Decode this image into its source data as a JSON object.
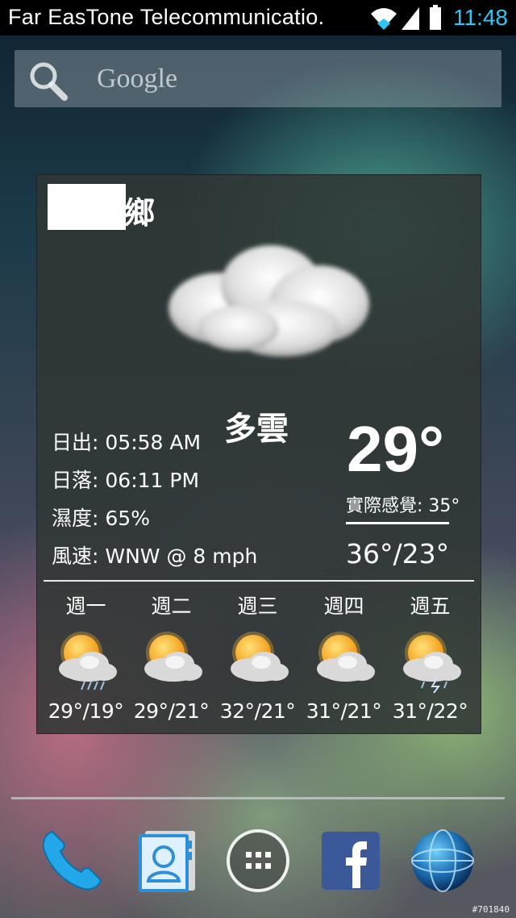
{
  "status_bar": {
    "carrier": "Far EasTone Telecommunicatio.",
    "time": "11:48",
    "icons": [
      "wifi-icon",
      "signal-icon",
      "battery-icon"
    ]
  },
  "search": {
    "placeholder": "Google",
    "icon": "search-icon"
  },
  "weather": {
    "location_suffix": "鄉",
    "condition": "多雲",
    "details": [
      {
        "label": "日出",
        "value": "05:58 AM"
      },
      {
        "label": "日落",
        "value": "06:11 PM"
      },
      {
        "label": "濕度",
        "value": "65%"
      },
      {
        "label": "風速",
        "value": "WNW @ 8 mph"
      }
    ],
    "temperature": "29°",
    "feels_like_label": "實際感覺",
    "feels_like": "35°",
    "high_low": "36°/23°",
    "forecast": [
      {
        "day": "週一",
        "temp": "29°/19°",
        "icon": "partly-cloudy-rain-icon"
      },
      {
        "day": "週二",
        "temp": "29°/21°",
        "icon": "partly-cloudy-icon"
      },
      {
        "day": "週三",
        "temp": "32°/21°",
        "icon": "partly-cloudy-icon"
      },
      {
        "day": "週四",
        "temp": "31°/21°",
        "icon": "partly-cloudy-icon"
      },
      {
        "day": "週五",
        "temp": "31°/22°",
        "icon": "thunderstorm-icon"
      }
    ]
  },
  "dock": [
    {
      "name": "phone-icon"
    },
    {
      "name": "contacts-icon"
    },
    {
      "name": "app-drawer-icon"
    },
    {
      "name": "facebook-icon"
    },
    {
      "name": "browser-globe-icon"
    }
  ],
  "watermark": "#701840",
  "colors": {
    "clock": "#2cc7f5",
    "facebook_blue": "#3b5998"
  }
}
